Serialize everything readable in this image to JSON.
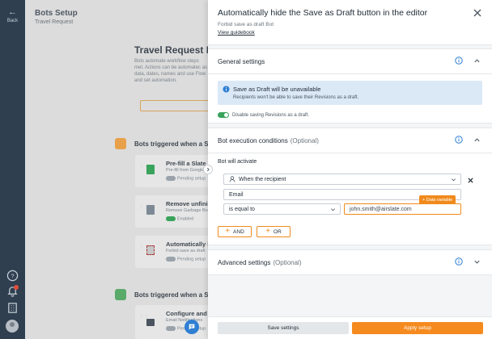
{
  "rail": {
    "back_label": "Back",
    "icons": [
      "help-icon",
      "bell-icon",
      "building-icon"
    ]
  },
  "background": {
    "title": "Bots Setup",
    "subtitle": "Travel Request",
    "heading": "Travel Request Bo",
    "description": "Bots automate workflow steps met. Actions can be automatec as data, dates, names and use Flow and set automation.",
    "section1": "Bots triggered when a Slate",
    "section2": "Bots triggered when a Slate",
    "cards": [
      {
        "title": "Pre-fill a Slate",
        "sub": "Pre-fill from Google",
        "status": "Pending setup",
        "on": false
      },
      {
        "title": "Remove unfinis",
        "sub": "Remove Garbage Bot",
        "status": "Enabled",
        "on": true
      },
      {
        "title": "Automatically h",
        "sub": "Forbid save as draft",
        "status": "Pending setup",
        "on": false
      },
      {
        "title": "Configure and",
        "sub": "Email Notifications",
        "status": "Pending setup",
        "on": false
      }
    ]
  },
  "panel": {
    "title": "Automatically hide the Save as Draft button in the editor",
    "subtitle": "Forbid save as draft Bot",
    "guide_link": "View guidebook",
    "general": {
      "title": "General settings",
      "alert_title": "Save as Draft will be unavailable",
      "alert_body": "Recipients won't be able to save their Revisions as a draft.",
      "toggle_label": "Disable saving Revisions as a draft.",
      "toggle_on": true
    },
    "conditions": {
      "title": "Bot execution conditions",
      "optional": "(Optional)",
      "activate_label": "Bot will activate",
      "trigger_value": "When the recipient",
      "field_value": "Email",
      "operator_value": "is equal to",
      "compare_value": "john.smith@airslate.com",
      "data_variable_label": "+ Data variable",
      "and_label": "AND",
      "or_label": "OR"
    },
    "advanced": {
      "title": "Advanced settings",
      "optional": "(Optional)"
    },
    "footer": {
      "save_label": "Save settings",
      "apply_label": "Apply setup"
    }
  },
  "colors": {
    "rail": "#2f3f4f",
    "accent": "#f58a1f",
    "info": "#2f7fd3",
    "alert_bg": "#dbe9f7",
    "toggle_on": "#3aa35c"
  }
}
